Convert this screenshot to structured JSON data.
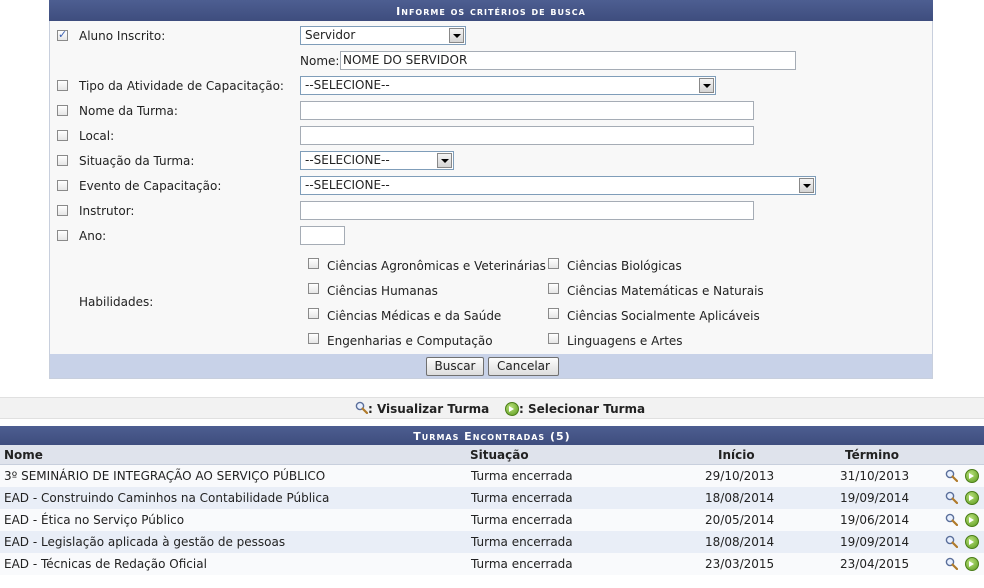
{
  "search": {
    "header": "Informe os critérios de busca",
    "aluno_label": "Aluno Inscrito:",
    "aluno_select": "Servidor",
    "nome_label": "Nome:",
    "nome_value": "NOME DO SERVIDOR",
    "tipo_label": "Tipo da Atividade de Capacitação:",
    "tipo_select": "--SELECIONE--",
    "turma_label": "Nome da Turma:",
    "local_label": "Local:",
    "situacao_label": "Situação da Turma:",
    "situacao_select": "--SELECIONE--",
    "evento_label": "Evento de Capacitação:",
    "evento_select": "--SELECIONE--",
    "instrutor_label": "Instrutor:",
    "ano_label": "Ano:",
    "habilidades_label": "Habilidades:",
    "habilidades": [
      "Ciências Agronômicas e Veterinárias",
      "Ciências Biológicas",
      "Ciências Humanas",
      "Ciências Matemáticas e Naturais",
      "Ciências Médicas e da Saúde",
      "Ciências Socialmente Aplicáveis",
      "Engenharias e Computação",
      "Linguagens e Artes"
    ],
    "buscar": "Buscar",
    "cancelar": "Cancelar"
  },
  "legend": {
    "visualizar": ": Visualizar Turma",
    "selecionar": ": Selecionar Turma"
  },
  "results": {
    "header": "Turmas Encontradas (5)",
    "columns": [
      "Nome",
      "Situação",
      "Início",
      "Término"
    ],
    "rows": [
      [
        "3º SEMINÁRIO DE INTEGRAÇÃO AO SERVIÇO PÚBLICO",
        "Turma encerrada",
        "29/10/2013",
        "31/10/2013"
      ],
      [
        "EAD - Construindo Caminhos na Contabilidade Pública",
        "Turma encerrada",
        "18/08/2014",
        "19/09/2014"
      ],
      [
        "EAD - Ética no Serviço Público",
        "Turma encerrada",
        "20/05/2014",
        "19/06/2014"
      ],
      [
        "EAD - Legislação aplicada à gestão de pessoas",
        "Turma encerrada",
        "18/08/2014",
        "19/09/2014"
      ],
      [
        "EAD - Técnicas de Redação Oficial",
        "Turma encerrada",
        "23/03/2015",
        "23/04/2015"
      ]
    ]
  },
  "icons": {
    "view": "magnifier-icon",
    "select": "green-arrow-icon"
  }
}
